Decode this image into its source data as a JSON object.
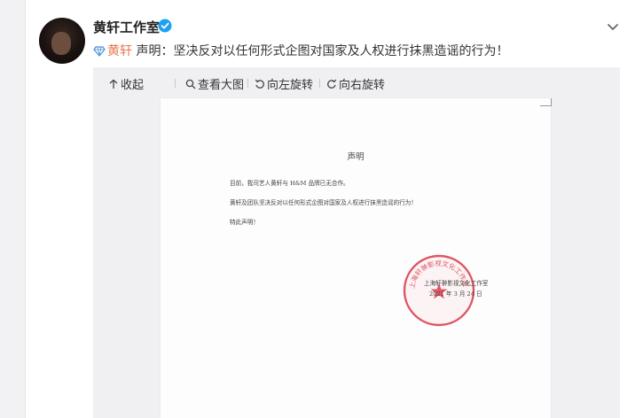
{
  "post": {
    "username": "黄轩工作室",
    "tag_name": "黄轩",
    "text": " 声明：坚决反对以任何形式企图对国家及人权进行抹黑造谣的行为！"
  },
  "toolbar": {
    "collapse": "收起",
    "view_large": "查看大图",
    "rotate_left": "向左旋转",
    "rotate_right": "向右旋转"
  },
  "document": {
    "title": "声明",
    "line1": "目前，我司艺人黄轩与 H&M 品牌已无合作。",
    "line2": "黄轩及团队坚决反对以任何形式企图对国家及人权进行抹黑造谣的行为！",
    "line3": "特此声明！",
    "org": "上海轩翀影视文化工作室",
    "date": "2021 年 3 月 24 日",
    "stamp_text": "上海轩翀影视文化工作室"
  },
  "colors": {
    "accent": "#eb7350",
    "verified": "#1da1f2",
    "stamp": "#d9394a"
  }
}
